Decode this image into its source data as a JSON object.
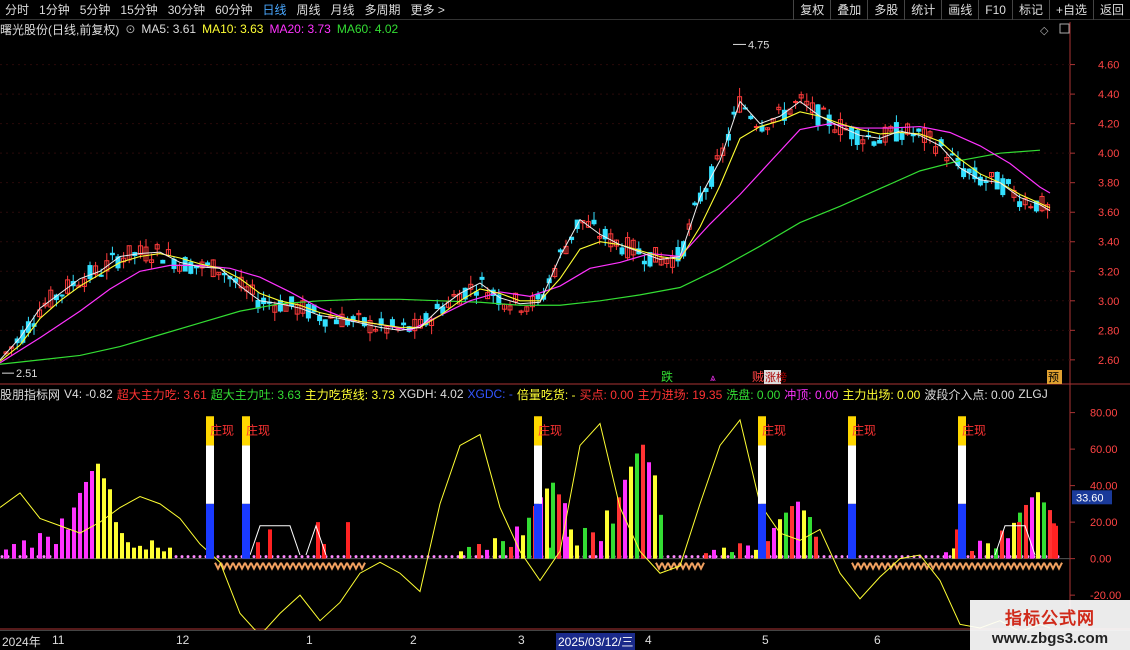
{
  "toolbar": {
    "periods": [
      "分时",
      "1分钟",
      "5分钟",
      "15分钟",
      "30分钟",
      "60分钟",
      "日线",
      "周线",
      "月线",
      "多周期",
      "更多 >"
    ],
    "active_period": "日线",
    "tools": [
      "复权",
      "叠加",
      "多股",
      "统计",
      "画线",
      "F10",
      "标记",
      "+自选",
      "返回"
    ]
  },
  "stock": {
    "name": "曙光股份(日线,前复权)",
    "ma5_label": "MA5: 3.61",
    "ma10_label": "MA10: 3.63",
    "ma20_label": "MA20: 3.73",
    "ma60_label": "MA60: 4.02"
  },
  "indicator": {
    "name": "股朋指标网",
    "labels": [
      "V4: -0.82",
      "超大主力吃: 3.61",
      "超大主力吐: 3.63",
      "主力吃货线: 3.73",
      "XGDH: 4.02",
      "XGDC: -",
      "倍量吃货: -",
      "买点: 0.00",
      "主力进场: 19.35",
      "洗盘: 0.00",
      "冲顶: 0.00",
      "主力出场: 0.00",
      "波段介入点: 0.00",
      "ZLGJ"
    ],
    "colors": [
      "#dddddd",
      "#ff3333",
      "#33dd33",
      "#ffff33",
      "#dddddd",
      "#3355ff",
      "#ffff33",
      "#ff3333",
      "#ff3333",
      "#33dd33",
      "#ff33ff",
      "#ffff33",
      "#dddddd",
      "#dddddd"
    ],
    "zhuangxian": "庄现",
    "highlight_value": "33.60"
  },
  "markers": {
    "die": "跌",
    "zhangting": "涨榜",
    "zhuan": "贼",
    "yu": "预",
    "high": "4.75",
    "low": "2.51"
  },
  "time_axis": [
    "2024年",
    "11",
    "12",
    "1",
    "2",
    "3",
    "2025/03/12/三",
    "4",
    "5",
    "6"
  ],
  "watermark": {
    "line1": "指标公式网",
    "line2": "www.zbgs3.com"
  },
  "chart_data": [
    {
      "type": "candlestick",
      "title": "曙光股份(日线,前复权)",
      "ylim": [
        2.45,
        4.78
      ],
      "yticks": [
        2.6,
        2.8,
        3.0,
        3.2,
        3.4,
        3.6,
        3.8,
        4.0,
        4.2,
        4.4,
        4.6
      ],
      "high_label": 4.75,
      "low_label": 2.51,
      "ma60_path": [
        [
          0,
          2.57
        ],
        [
          40,
          2.6
        ],
        [
          80,
          2.63
        ],
        [
          120,
          2.69
        ],
        [
          160,
          2.77
        ],
        [
          200,
          2.85
        ],
        [
          240,
          2.93
        ],
        [
          280,
          2.98
        ],
        [
          320,
          3.0
        ],
        [
          360,
          3.01
        ],
        [
          400,
          3.01
        ],
        [
          440,
          3.0
        ],
        [
          480,
          2.99
        ],
        [
          520,
          2.97
        ],
        [
          560,
          2.97
        ],
        [
          600,
          3.0
        ],
        [
          640,
          3.04
        ],
        [
          680,
          3.09
        ],
        [
          720,
          3.22
        ],
        [
          760,
          3.37
        ],
        [
          800,
          3.53
        ],
        [
          840,
          3.64
        ],
        [
          880,
          3.76
        ],
        [
          920,
          3.88
        ],
        [
          960,
          3.95
        ],
        [
          1000,
          4.0
        ],
        [
          1040,
          4.02
        ]
      ],
      "ma20_path": [
        [
          0,
          2.58
        ],
        [
          40,
          2.75
        ],
        [
          80,
          2.93
        ],
        [
          110,
          3.08
        ],
        [
          140,
          3.2
        ],
        [
          170,
          3.24
        ],
        [
          200,
          3.24
        ],
        [
          230,
          3.22
        ],
        [
          260,
          3.16
        ],
        [
          290,
          3.06
        ],
        [
          320,
          2.95
        ],
        [
          350,
          2.87
        ],
        [
          380,
          2.84
        ],
        [
          410,
          2.8
        ],
        [
          440,
          2.9
        ],
        [
          470,
          3.0
        ],
        [
          500,
          3.06
        ],
        [
          530,
          3.03
        ],
        [
          560,
          3.1
        ],
        [
          590,
          3.22
        ],
        [
          620,
          3.26
        ],
        [
          650,
          3.32
        ],
        [
          680,
          3.3
        ],
        [
          710,
          3.52
        ],
        [
          740,
          3.72
        ],
        [
          770,
          3.94
        ],
        [
          800,
          4.16
        ],
        [
          830,
          4.2
        ],
        [
          860,
          4.17
        ],
        [
          890,
          4.17
        ],
        [
          920,
          4.18
        ],
        [
          950,
          4.14
        ],
        [
          980,
          4.05
        ],
        [
          1010,
          3.93
        ],
        [
          1040,
          3.77
        ],
        [
          1050,
          3.73
        ]
      ],
      "ma5_path": [
        [
          0,
          2.6
        ],
        [
          20,
          2.75
        ],
        [
          40,
          2.95
        ],
        [
          60,
          3.05
        ],
        [
          80,
          3.15
        ],
        [
          100,
          3.2
        ],
        [
          120,
          3.3
        ],
        [
          140,
          3.32
        ],
        [
          160,
          3.33
        ],
        [
          180,
          3.26
        ],
        [
          200,
          3.23
        ],
        [
          220,
          3.22
        ],
        [
          240,
          3.1
        ],
        [
          260,
          3.0
        ],
        [
          280,
          2.98
        ],
        [
          300,
          2.95
        ],
        [
          320,
          2.9
        ],
        [
          340,
          2.88
        ],
        [
          360,
          2.85
        ],
        [
          380,
          2.82
        ],
        [
          400,
          2.8
        ],
        [
          420,
          2.82
        ],
        [
          440,
          2.95
        ],
        [
          460,
          3.05
        ],
        [
          480,
          3.12
        ],
        [
          500,
          3.02
        ],
        [
          520,
          2.98
        ],
        [
          540,
          2.99
        ],
        [
          560,
          3.3
        ],
        [
          580,
          3.55
        ],
        [
          600,
          3.45
        ],
        [
          620,
          3.38
        ],
        [
          640,
          3.33
        ],
        [
          660,
          3.28
        ],
        [
          680,
          3.3
        ],
        [
          700,
          3.7
        ],
        [
          720,
          3.95
        ],
        [
          740,
          4.35
        ],
        [
          760,
          4.2
        ],
        [
          780,
          4.25
        ],
        [
          800,
          4.35
        ],
        [
          820,
          4.25
        ],
        [
          840,
          4.18
        ],
        [
          860,
          4.12
        ],
        [
          880,
          4.1
        ],
        [
          900,
          4.15
        ],
        [
          920,
          4.12
        ],
        [
          940,
          4.05
        ],
        [
          960,
          3.9
        ],
        [
          980,
          3.82
        ],
        [
          1000,
          3.8
        ],
        [
          1020,
          3.7
        ],
        [
          1040,
          3.65
        ],
        [
          1050,
          3.61
        ]
      ],
      "ma10_path": [
        [
          0,
          2.59
        ],
        [
          20,
          2.7
        ],
        [
          40,
          2.88
        ],
        [
          60,
          3.0
        ],
        [
          80,
          3.1
        ],
        [
          100,
          3.18
        ],
        [
          120,
          3.26
        ],
        [
          140,
          3.3
        ],
        [
          160,
          3.32
        ],
        [
          180,
          3.29
        ],
        [
          200,
          3.25
        ],
        [
          220,
          3.22
        ],
        [
          240,
          3.15
        ],
        [
          260,
          3.05
        ],
        [
          280,
          3.0
        ],
        [
          300,
          2.97
        ],
        [
          320,
          2.92
        ],
        [
          340,
          2.89
        ],
        [
          360,
          2.86
        ],
        [
          380,
          2.84
        ],
        [
          400,
          2.82
        ],
        [
          420,
          2.82
        ],
        [
          440,
          2.9
        ],
        [
          460,
          3.0
        ],
        [
          480,
          3.08
        ],
        [
          500,
          3.05
        ],
        [
          520,
          3.0
        ],
        [
          540,
          3.0
        ],
        [
          560,
          3.15
        ],
        [
          580,
          3.35
        ],
        [
          600,
          3.4
        ],
        [
          620,
          3.38
        ],
        [
          640,
          3.34
        ],
        [
          660,
          3.3
        ],
        [
          680,
          3.28
        ],
        [
          700,
          3.5
        ],
        [
          720,
          3.78
        ],
        [
          740,
          4.1
        ],
        [
          760,
          4.18
        ],
        [
          780,
          4.22
        ],
        [
          800,
          4.28
        ],
        [
          820,
          4.25
        ],
        [
          840,
          4.2
        ],
        [
          860,
          4.16
        ],
        [
          880,
          4.13
        ],
        [
          900,
          4.14
        ],
        [
          920,
          4.13
        ],
        [
          940,
          4.08
        ],
        [
          960,
          3.96
        ],
        [
          980,
          3.86
        ],
        [
          1000,
          3.8
        ],
        [
          1020,
          3.72
        ],
        [
          1040,
          3.66
        ],
        [
          1050,
          3.63
        ]
      ]
    },
    {
      "type": "bar",
      "title": "股朋指标网",
      "ylim": [
        -38,
        88
      ],
      "yticks": [
        80.0,
        60.0,
        40.0,
        20.0,
        0.0,
        -20.0
      ],
      "bar_segments": [
        [
          4,
          5
        ],
        [
          12,
          8
        ],
        [
          22,
          10
        ],
        [
          30,
          6
        ],
        [
          38,
          14
        ],
        [
          46,
          12
        ],
        [
          54,
          8
        ],
        [
          60,
          22
        ],
        [
          66,
          16
        ],
        [
          72,
          28
        ],
        [
          78,
          36
        ],
        [
          84,
          42
        ],
        [
          90,
          48
        ],
        [
          96,
          52
        ],
        [
          102,
          44
        ],
        [
          108,
          38
        ],
        [
          114,
          20
        ],
        [
          120,
          14
        ],
        [
          126,
          9
        ],
        [
          132,
          6
        ],
        [
          138,
          7
        ],
        [
          144,
          5
        ],
        [
          150,
          10
        ],
        [
          156,
          6
        ],
        [
          162,
          4
        ],
        [
          168,
          6
        ]
      ],
      "yellow_line": [
        [
          0,
          28
        ],
        [
          20,
          36
        ],
        [
          40,
          22
        ],
        [
          60,
          18
        ],
        [
          80,
          14
        ],
        [
          100,
          20
        ],
        [
          120,
          28
        ],
        [
          140,
          34
        ],
        [
          160,
          30
        ],
        [
          180,
          22
        ],
        [
          200,
          8
        ],
        [
          220,
          -2
        ],
        [
          240,
          -30
        ],
        [
          260,
          -42
        ],
        [
          280,
          -30
        ],
        [
          300,
          -20
        ],
        [
          320,
          -34
        ],
        [
          340,
          -24
        ],
        [
          360,
          -8
        ],
        [
          380,
          -2
        ],
        [
          400,
          -8
        ],
        [
          420,
          -18
        ],
        [
          440,
          30
        ],
        [
          460,
          62
        ],
        [
          480,
          68
        ],
        [
          500,
          28
        ],
        [
          520,
          4
        ],
        [
          540,
          -12
        ],
        [
          560,
          4
        ],
        [
          580,
          62
        ],
        [
          600,
          74
        ],
        [
          620,
          28
        ],
        [
          640,
          4
        ],
        [
          660,
          -8
        ],
        [
          680,
          -4
        ],
        [
          700,
          30
        ],
        [
          720,
          62
        ],
        [
          740,
          76
        ],
        [
          760,
          30
        ],
        [
          780,
          14
        ],
        [
          800,
          10
        ],
        [
          820,
          16
        ],
        [
          840,
          -8
        ],
        [
          860,
          -22
        ],
        [
          880,
          -10
        ],
        [
          900,
          0
        ],
        [
          920,
          2
        ],
        [
          940,
          -12
        ],
        [
          960,
          -36
        ],
        [
          980,
          -38
        ],
        [
          1000,
          -34
        ],
        [
          1020,
          -40
        ],
        [
          1040,
          -36
        ],
        [
          1050,
          -38
        ]
      ],
      "zhuangxian_x": [
        210,
        246,
        538,
        762,
        852,
        962
      ],
      "series": [
        {
          "name": "主力进场",
          "values": [
            19.35
          ]
        }
      ]
    }
  ]
}
